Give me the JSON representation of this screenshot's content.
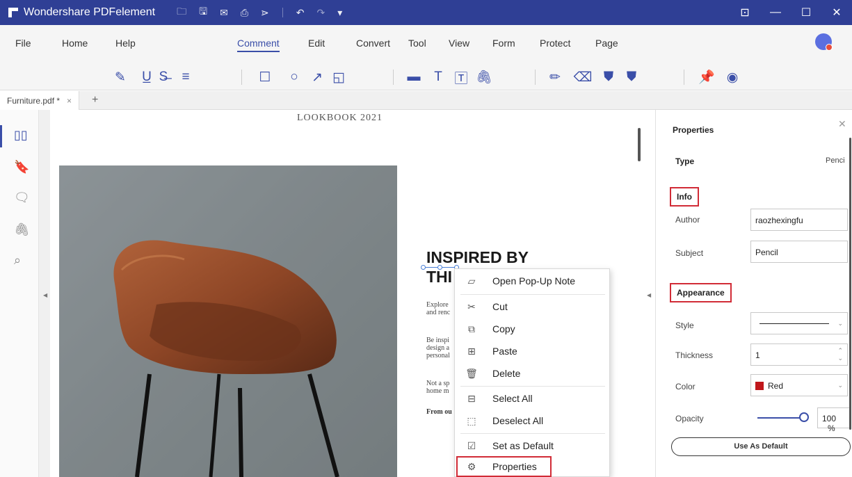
{
  "titlebar": {
    "app_title": "Wondershare PDFelement",
    "quick_icons": [
      "folder-icon",
      "save-icon",
      "mail-icon",
      "print-icon",
      "share-icon",
      "undo-icon",
      "redo-icon",
      "customize-icon"
    ],
    "window_controls": [
      "minimize",
      "maximize",
      "close"
    ]
  },
  "menubar": {
    "items": [
      "File",
      "Home",
      "Help",
      "Comment",
      "Edit",
      "Convert",
      "Tool",
      "View",
      "Form",
      "Protect",
      "Page"
    ],
    "active": "Comment"
  },
  "toolbar": {
    "tools": [
      "highlight-icon",
      "underline-icon",
      "strikethrough-icon",
      "replace-text-icon",
      "rectangle-icon",
      "oval-icon",
      "arrow-icon",
      "shape-icon",
      "note-icon",
      "typewriter-icon",
      "textbox-icon",
      "attachment-icon",
      "pencil-icon",
      "eraser-icon",
      "stamp-icon",
      "signature-icon",
      "pin-icon",
      "eye-icon"
    ]
  },
  "tab": {
    "filename": "Furniture.pdf *",
    "close": "×",
    "add": "+"
  },
  "document": {
    "header": "LOOKBOOK 2021",
    "heading_line1": "INSPIRED BY",
    "heading_line2": "THI",
    "para1_line1": "Explore",
    "para1_line2": "and renc",
    "para2_line1": "Be inspi",
    "para2_line2": "design a",
    "para2_line3": "personal",
    "para3_line1": "Not a sp",
    "para3_line2": "home m",
    "para4": "From ou"
  },
  "context_menu": {
    "items": [
      {
        "label": "Open Pop-Up Note",
        "icon": "popup-note-icon"
      },
      {
        "label": "Cut",
        "icon": "scissors-icon"
      },
      {
        "label": "Copy",
        "icon": "copy-icon"
      },
      {
        "label": "Paste",
        "icon": "paste-icon"
      },
      {
        "label": "Delete",
        "icon": "trash-icon"
      },
      {
        "label": "Select All",
        "icon": "select-all-icon"
      },
      {
        "label": "Deselect All",
        "icon": "deselect-all-icon"
      },
      {
        "label": "Set as Default",
        "icon": "checkbox-icon"
      },
      {
        "label": "Properties",
        "icon": "gear-icon"
      }
    ],
    "highlighted": "Properties"
  },
  "properties": {
    "title": "Properties",
    "type_label": "Type",
    "type_value": "Penci",
    "info_section": "Info",
    "author_label": "Author",
    "author_value": "raozhexingfu",
    "subject_label": "Subject",
    "subject_value": "Pencil",
    "appearance_section": "Appearance",
    "style_label": "Style",
    "thickness_label": "Thickness",
    "thickness_value": "1",
    "color_label": "Color",
    "color_value": "Red",
    "color_hex": "#c0171b",
    "opacity_label": "Opacity",
    "opacity_value": "100",
    "opacity_unit": "%",
    "use_default_label": "Use As Default"
  },
  "colors": {
    "titlebar": "#2f3f95",
    "accent": "#3a4ea8",
    "highlight_border": "#d12b36"
  }
}
